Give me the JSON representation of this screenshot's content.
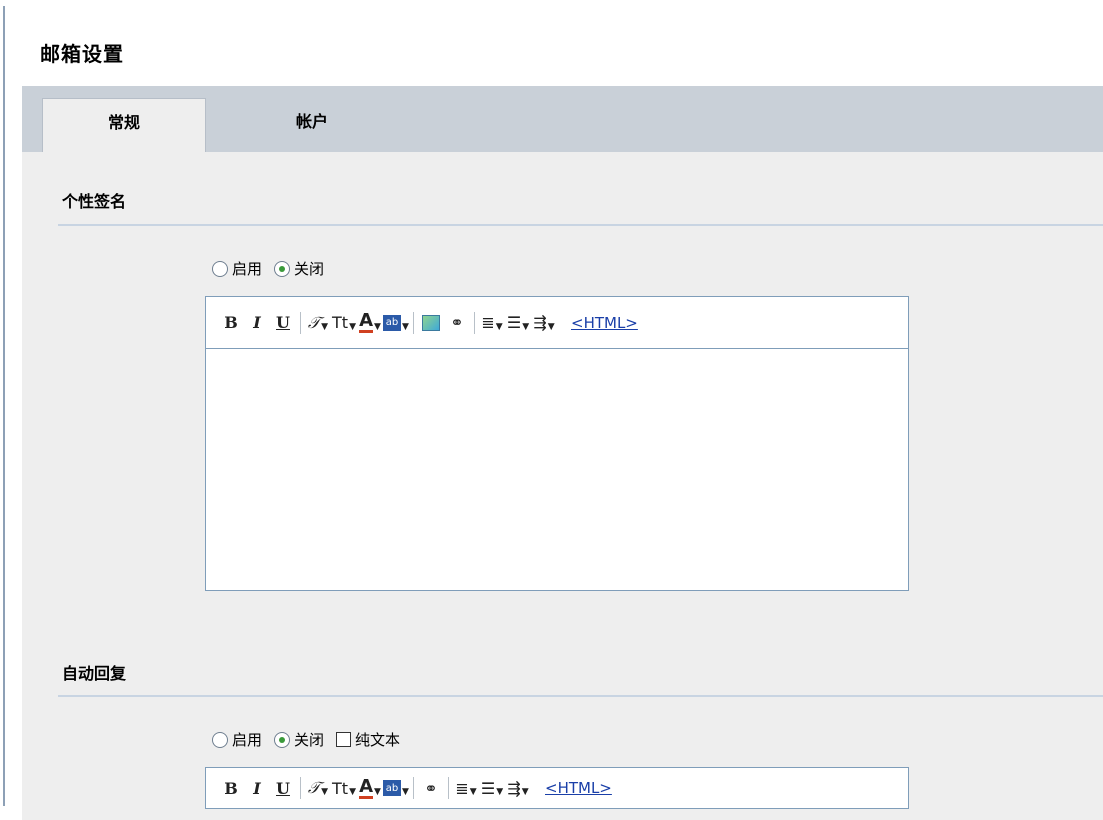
{
  "page": {
    "title": "邮箱设置"
  },
  "tabs": [
    {
      "label": "常规"
    },
    {
      "label": "帐户"
    }
  ],
  "signature": {
    "title": "个性签名",
    "options": [
      {
        "label": "启用",
        "selected": false
      },
      {
        "label": "关闭",
        "selected": true
      }
    ],
    "html_link": "<HTML>"
  },
  "auto_reply": {
    "title": "自动回复",
    "options": [
      {
        "label": "启用",
        "selected": false
      },
      {
        "label": "关闭",
        "selected": true
      }
    ],
    "plaintext_label": "纯文本",
    "plaintext_checked": false,
    "html_link": "<HTML>"
  },
  "toolbar": {
    "bold": "B",
    "italic": "I",
    "underline": "U",
    "font_size": "Tt",
    "font_color": "A",
    "highlight": "ab"
  },
  "colors": {
    "tabbar": "#c9d0d8",
    "content_bg": "#eeeeee",
    "editor_border": "#7f9db9",
    "link": "#1a3fa8",
    "radio_dot": "#3a9a3a"
  }
}
